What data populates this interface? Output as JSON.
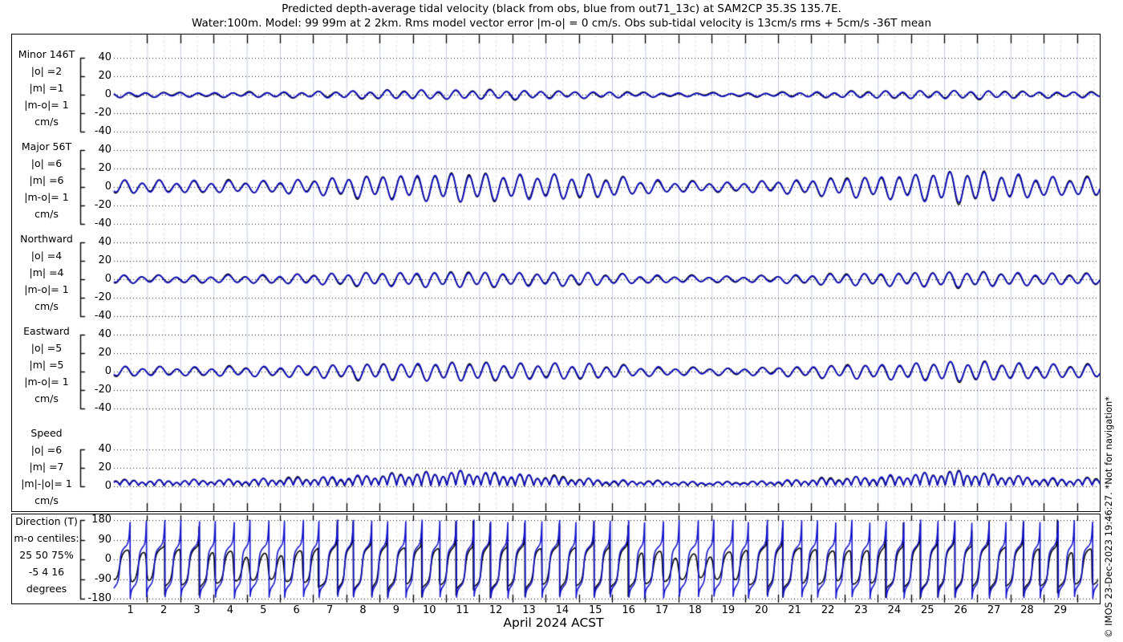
{
  "title": {
    "line1": "Predicted depth-average tidal velocity (black from obs, blue from out71_13c) at SAM2CP 35.3S 135.7E.",
    "line2": "Water:100m. Model: 99 99m at 2 2km. Rms model vector error |m-o| = 0 cm/s. Obs sub-tidal velocity is 13cm/s rms + 5cm/s -36T mean"
  },
  "watermark": "© IMOS 23-Dec-2023 19:46:27. *Not for navigation*",
  "colors": {
    "obs_line": "#000000",
    "model_line": "#1212cc",
    "day_gridline": "#c3cbdf",
    "halfday_gridline": "#ecd9d9",
    "dotted_gridline": "#161616"
  },
  "x_axis": {
    "label": "April 2024 ACST",
    "day_labels": [
      "1",
      "2",
      "3",
      "4",
      "5",
      "6",
      "7",
      "8",
      "9",
      "10",
      "11",
      "12",
      "13",
      "14",
      "15",
      "16",
      "17",
      "18",
      "19",
      "20",
      "21",
      "22",
      "23",
      "24",
      "25",
      "26",
      "27",
      "28",
      "29"
    ],
    "start_day": 0,
    "end_day": 29.7,
    "gridlines": "solid at each midnight, dashed pink at each noon"
  },
  "chart_data": [
    {
      "type": "line",
      "id": "minor",
      "label_lines": [
        "Minor 146T",
        "|o| =2",
        "|m| =1",
        "|m-o|= 1",
        "cm/s"
      ],
      "yticks": [
        40,
        20,
        0,
        -20,
        -40
      ],
      "ylim": [
        -40,
        40
      ],
      "series": [
        {
          "name": "obs",
          "color": "#000000"
        },
        {
          "name": "model out71_13c",
          "color": "#1212cc"
        }
      ],
      "signal": "semidiurnal tidal oscillation, minor-axis component (146T)",
      "amplitude_envelope_cm_s": [
        [
          0,
          3
        ],
        [
          3,
          3
        ],
        [
          6,
          3.5
        ],
        [
          9,
          4.5
        ],
        [
          12,
          4.5
        ],
        [
          15,
          3.5
        ],
        [
          17,
          2.5
        ],
        [
          19,
          2.2
        ],
        [
          21,
          3
        ],
        [
          24,
          3.8
        ],
        [
          26,
          4
        ],
        [
          28,
          3.2
        ],
        [
          30,
          3.5
        ]
      ]
    },
    {
      "type": "line",
      "id": "major",
      "label_lines": [
        "Major 56T",
        "|o| =6",
        "|m| =6",
        "|m-o|= 1",
        "cm/s"
      ],
      "yticks": [
        40,
        20,
        0,
        -20,
        -40
      ],
      "ylim": [
        -40,
        40
      ],
      "series": [
        {
          "name": "obs",
          "color": "#000000"
        },
        {
          "name": "model out71_13c",
          "color": "#1212cc"
        }
      ],
      "signal": "semidiurnal tidal oscillation, major-axis component (56T), spring-neap modulated",
      "amplitude_envelope_cm_s": [
        [
          0,
          8
        ],
        [
          2,
          8.5
        ],
        [
          4,
          7.5
        ],
        [
          6,
          9
        ],
        [
          8,
          12
        ],
        [
          10,
          14
        ],
        [
          12,
          13
        ],
        [
          14,
          14
        ],
        [
          15.5,
          11
        ],
        [
          17,
          7.5
        ],
        [
          18.5,
          6
        ],
        [
          20,
          8
        ],
        [
          22,
          10
        ],
        [
          24,
          13
        ],
        [
          25,
          15
        ],
        [
          26,
          15
        ],
        [
          27,
          13.5
        ],
        [
          28,
          11
        ],
        [
          29,
          10
        ],
        [
          30,
          12
        ]
      ]
    },
    {
      "type": "line",
      "id": "northward",
      "label_lines": [
        "Northward",
        "|o| =4",
        "|m| =4",
        "|m-o|= 1",
        "cm/s"
      ],
      "yticks": [
        40,
        20,
        0,
        -20,
        -40
      ],
      "ylim": [
        -40,
        40
      ],
      "series": [
        {
          "name": "obs",
          "color": "#000000"
        },
        {
          "name": "model out71_13c",
          "color": "#1212cc"
        }
      ],
      "signal": "northward tidal velocity component",
      "amplitude_envelope_cm_s": [
        [
          0,
          5
        ],
        [
          3,
          5
        ],
        [
          6,
          6
        ],
        [
          8,
          7
        ],
        [
          10,
          7.5
        ],
        [
          12,
          7
        ],
        [
          14,
          7.5
        ],
        [
          16,
          5.5
        ],
        [
          18,
          4
        ],
        [
          19,
          4
        ],
        [
          21,
          5.5
        ],
        [
          23,
          6.5
        ],
        [
          25,
          7.5
        ],
        [
          27,
          7
        ],
        [
          29,
          6
        ],
        [
          30,
          6.5
        ]
      ]
    },
    {
      "type": "line",
      "id": "eastward",
      "label_lines": [
        "Eastward",
        "|o| =5",
        "|m| =5",
        "|m-o|= 1",
        "cm/s"
      ],
      "yticks": [
        40,
        20,
        0,
        -20,
        -40
      ],
      "ylim": [
        -40,
        40
      ],
      "series": [
        {
          "name": "obs",
          "color": "#000000"
        },
        {
          "name": "model out71_13c",
          "color": "#1212cc"
        }
      ],
      "signal": "eastward tidal velocity component",
      "amplitude_envelope_cm_s": [
        [
          0,
          6
        ],
        [
          3,
          6
        ],
        [
          6,
          7
        ],
        [
          8,
          8.5
        ],
        [
          10,
          9
        ],
        [
          12,
          8.5
        ],
        [
          14,
          9
        ],
        [
          16,
          6.5
        ],
        [
          18,
          4.5
        ],
        [
          19,
          4.5
        ],
        [
          21,
          6.5
        ],
        [
          23,
          7.5
        ],
        [
          25,
          9.5
        ],
        [
          26,
          9.5
        ],
        [
          28,
          8
        ],
        [
          30,
          7.5
        ]
      ]
    },
    {
      "type": "line",
      "id": "speed",
      "label_lines": [
        "Speed",
        "|o| =6",
        "|m| =7",
        "|m|-|o|= 1",
        "cm/s"
      ],
      "yticks": [
        40,
        20,
        0
      ],
      "ylim": [
        0,
        45
      ],
      "series": [
        {
          "name": "obs",
          "color": "#000000"
        },
        {
          "name": "model out71_13c",
          "color": "#1212cc"
        }
      ],
      "signal": "current speed, positive humps twice daily, spring-neap modulated",
      "amplitude_envelope_cm_s": [
        [
          0,
          6
        ],
        [
          2,
          7
        ],
        [
          4,
          8
        ],
        [
          6,
          9
        ],
        [
          8,
          11
        ],
        [
          10,
          13
        ],
        [
          10.5,
          14
        ],
        [
          12,
          12
        ],
        [
          13,
          10
        ],
        [
          14,
          8
        ],
        [
          15,
          6.5
        ],
        [
          16,
          6
        ],
        [
          17,
          5
        ],
        [
          18,
          4.5
        ],
        [
          19,
          4.5
        ],
        [
          20,
          6
        ],
        [
          21,
          7
        ],
        [
          22,
          8
        ],
        [
          23,
          9.5
        ],
        [
          24,
          11
        ],
        [
          25,
          13
        ],
        [
          25.5,
          14
        ],
        [
          26,
          12
        ],
        [
          27,
          10
        ],
        [
          28,
          8
        ],
        [
          29,
          7.5
        ],
        [
          30,
          9
        ]
      ]
    },
    {
      "type": "line",
      "id": "direction",
      "label_lines": [
        "Direction (T)",
        "m-o centiles:",
        "25  50  75%",
        "-5   4  16",
        "degrees"
      ],
      "yticks": [
        180,
        90,
        0,
        -90,
        -180
      ],
      "ylim": [
        -180,
        180
      ],
      "series": [
        {
          "name": "obs",
          "color": "#000000"
        },
        {
          "name": "model out71_13c",
          "color": "#1212cc"
        }
      ],
      "signal": "current direction (degrees true), wrapping sawtooth between +180 and -180, rotating through 360 deg each semidiurnal cycle around major axis 56T"
    }
  ]
}
